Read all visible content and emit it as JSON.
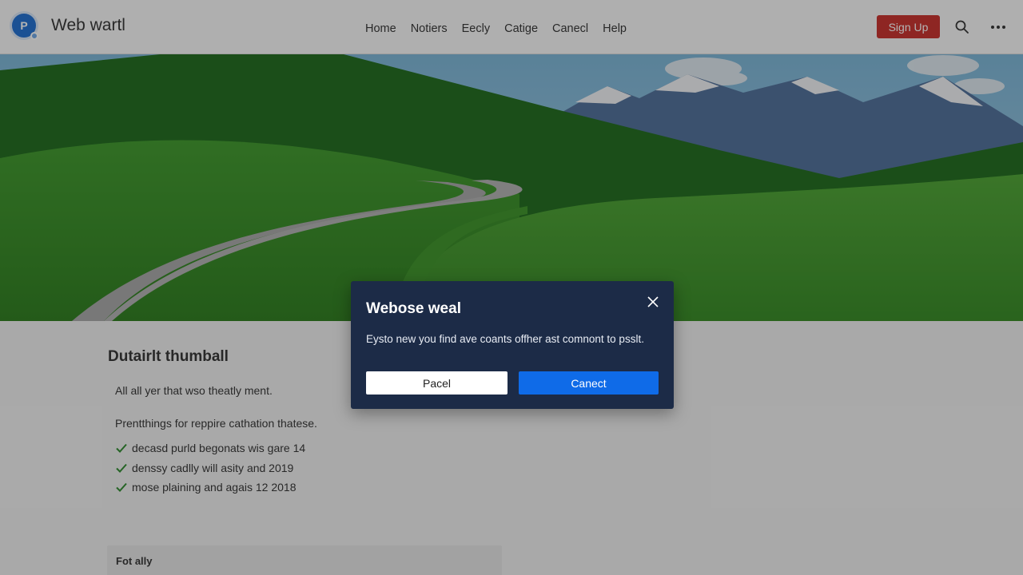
{
  "header": {
    "logo_text": "P",
    "site_title": "Web wartl",
    "nav": [
      {
        "label": "Home"
      },
      {
        "label": "Notiers"
      },
      {
        "label": "Eecly"
      },
      {
        "label": "Catige"
      },
      {
        "label": "Canecl"
      },
      {
        "label": "Help"
      }
    ],
    "signup_label": "Sign Up",
    "icons": [
      "search-icon",
      "more-icon"
    ]
  },
  "hero": {
    "image": "landscape with green hills, winding road and snowy mountains"
  },
  "content": {
    "title": "Dutairlt thumball",
    "intro": "All all yer that wso theatly ment.",
    "lead": "Prentthings for reppire cathation thatese.",
    "checklist": [
      {
        "text": "decasd purld begonats wis gare 14"
      },
      {
        "text": "denssy cadlly will asity and 2019"
      },
      {
        "text": "mose plaining and agais 12 2018"
      }
    ],
    "card_title": "Fot ally"
  },
  "modal": {
    "title": "Webose weal",
    "body": "Eysto new you find ave coants offher ast comnont to psslt.",
    "secondary_label": "Pacel",
    "primary_label": "Canect"
  },
  "colors": {
    "brand": "#1f6fd1",
    "signup": "#c9302c",
    "modal_bg": "#1c2b47",
    "primary_button": "#0f6be8",
    "check": "#2e8b2e"
  }
}
